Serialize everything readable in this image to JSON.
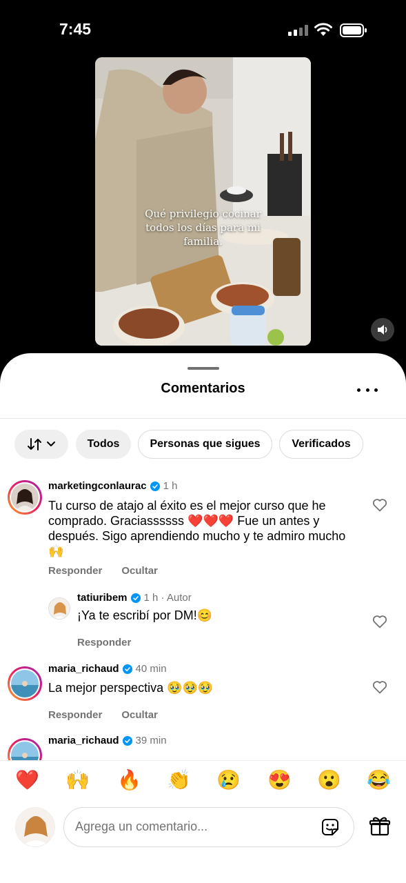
{
  "status_bar": {
    "time": "7:45"
  },
  "video": {
    "caption": "Qué privilegio cocinar todos los días para mi familia."
  },
  "sheet": {
    "title": "Comentarios"
  },
  "filters": {
    "chips": [
      "Todos",
      "Personas que sigues",
      "Verificados"
    ]
  },
  "comments": [
    {
      "user": "marketingconlaurac",
      "time": "1 h",
      "text": "Tu curso de atajo al éxito es el mejor curso que he comprado. Graciassssss ❤️❤️❤️ Fue un antes y después. Sigo aprendiendo mucho y te admiro mucho 🙌",
      "reply_label": "Responder",
      "hide_label": "Ocultar"
    },
    {
      "user": "tatiuribem",
      "time": "1 h · Autor",
      "text": "¡Ya te escribí por DM!😊",
      "reply_label": "Responder"
    },
    {
      "user": "maria_richaud",
      "time": "40 min",
      "text": "La mejor perspectiva 🥹🥹🥹",
      "reply_label": "Responder",
      "hide_label": "Ocultar"
    },
    {
      "user": "maria_richaud",
      "time": "39 min",
      "text": ""
    }
  ],
  "reactions": [
    "❤️",
    "🙌",
    "🔥",
    "👏",
    "😢",
    "😍",
    "😮",
    "😂"
  ],
  "composer": {
    "placeholder": "Agrega un comentario..."
  },
  "icons": {
    "verified": "verified-badge-icon",
    "like": "heart-outline-icon",
    "sort": "sort-arrows-icon",
    "sticker": "sticker-icon",
    "gift": "gift-icon",
    "mute": "speaker-muted-icon",
    "more": "more-dots-icon"
  },
  "colors": {
    "verified": "#0095f6",
    "secondary_text": "#737373"
  }
}
